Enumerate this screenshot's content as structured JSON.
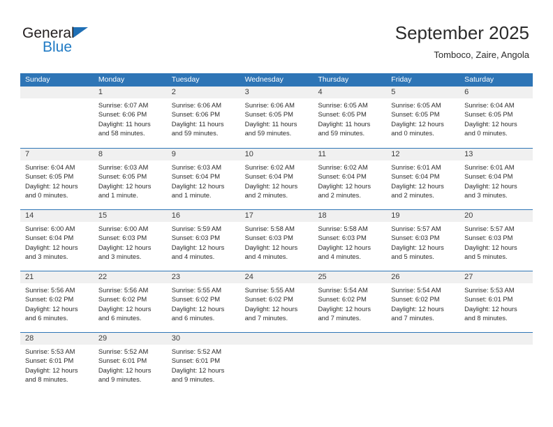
{
  "brand": {
    "name_top": "General",
    "name_bottom": "Blue",
    "triangle_icon": "triangle-icon",
    "color_primary": "#1f7ac4",
    "color_text": "#231f20"
  },
  "header": {
    "title": "September 2025",
    "subtitle": "Tomboco, Zaire, Angola"
  },
  "theme": {
    "header_row_bg": "#2e75b6",
    "day_number_bg": "#f0f0f0",
    "week_separator": "#2e75b6",
    "text": "#2b2b2b"
  },
  "weekdays": [
    "Sunday",
    "Monday",
    "Tuesday",
    "Wednesday",
    "Thursday",
    "Friday",
    "Saturday"
  ],
  "weeks": [
    [
      {
        "day": "",
        "empty": true,
        "sunrise": "",
        "sunset": "",
        "daylight_line1": "",
        "daylight_line2": ""
      },
      {
        "day": "1",
        "sunrise": "Sunrise: 6:07 AM",
        "sunset": "Sunset: 6:06 PM",
        "daylight_line1": "Daylight: 11 hours",
        "daylight_line2": "and 58 minutes."
      },
      {
        "day": "2",
        "sunrise": "Sunrise: 6:06 AM",
        "sunset": "Sunset: 6:06 PM",
        "daylight_line1": "Daylight: 11 hours",
        "daylight_line2": "and 59 minutes."
      },
      {
        "day": "3",
        "sunrise": "Sunrise: 6:06 AM",
        "sunset": "Sunset: 6:05 PM",
        "daylight_line1": "Daylight: 11 hours",
        "daylight_line2": "and 59 minutes."
      },
      {
        "day": "4",
        "sunrise": "Sunrise: 6:05 AM",
        "sunset": "Sunset: 6:05 PM",
        "daylight_line1": "Daylight: 11 hours",
        "daylight_line2": "and 59 minutes."
      },
      {
        "day": "5",
        "sunrise": "Sunrise: 6:05 AM",
        "sunset": "Sunset: 6:05 PM",
        "daylight_line1": "Daylight: 12 hours",
        "daylight_line2": "and 0 minutes."
      },
      {
        "day": "6",
        "sunrise": "Sunrise: 6:04 AM",
        "sunset": "Sunset: 6:05 PM",
        "daylight_line1": "Daylight: 12 hours",
        "daylight_line2": "and 0 minutes."
      }
    ],
    [
      {
        "day": "7",
        "sunrise": "Sunrise: 6:04 AM",
        "sunset": "Sunset: 6:05 PM",
        "daylight_line1": "Daylight: 12 hours",
        "daylight_line2": "and 0 minutes."
      },
      {
        "day": "8",
        "sunrise": "Sunrise: 6:03 AM",
        "sunset": "Sunset: 6:05 PM",
        "daylight_line1": "Daylight: 12 hours",
        "daylight_line2": "and 1 minute."
      },
      {
        "day": "9",
        "sunrise": "Sunrise: 6:03 AM",
        "sunset": "Sunset: 6:04 PM",
        "daylight_line1": "Daylight: 12 hours",
        "daylight_line2": "and 1 minute."
      },
      {
        "day": "10",
        "sunrise": "Sunrise: 6:02 AM",
        "sunset": "Sunset: 6:04 PM",
        "daylight_line1": "Daylight: 12 hours",
        "daylight_line2": "and 2 minutes."
      },
      {
        "day": "11",
        "sunrise": "Sunrise: 6:02 AM",
        "sunset": "Sunset: 6:04 PM",
        "daylight_line1": "Daylight: 12 hours",
        "daylight_line2": "and 2 minutes."
      },
      {
        "day": "12",
        "sunrise": "Sunrise: 6:01 AM",
        "sunset": "Sunset: 6:04 PM",
        "daylight_line1": "Daylight: 12 hours",
        "daylight_line2": "and 2 minutes."
      },
      {
        "day": "13",
        "sunrise": "Sunrise: 6:01 AM",
        "sunset": "Sunset: 6:04 PM",
        "daylight_line1": "Daylight: 12 hours",
        "daylight_line2": "and 3 minutes."
      }
    ],
    [
      {
        "day": "14",
        "sunrise": "Sunrise: 6:00 AM",
        "sunset": "Sunset: 6:04 PM",
        "daylight_line1": "Daylight: 12 hours",
        "daylight_line2": "and 3 minutes."
      },
      {
        "day": "15",
        "sunrise": "Sunrise: 6:00 AM",
        "sunset": "Sunset: 6:03 PM",
        "daylight_line1": "Daylight: 12 hours",
        "daylight_line2": "and 3 minutes."
      },
      {
        "day": "16",
        "sunrise": "Sunrise: 5:59 AM",
        "sunset": "Sunset: 6:03 PM",
        "daylight_line1": "Daylight: 12 hours",
        "daylight_line2": "and 4 minutes."
      },
      {
        "day": "17",
        "sunrise": "Sunrise: 5:58 AM",
        "sunset": "Sunset: 6:03 PM",
        "daylight_line1": "Daylight: 12 hours",
        "daylight_line2": "and 4 minutes."
      },
      {
        "day": "18",
        "sunrise": "Sunrise: 5:58 AM",
        "sunset": "Sunset: 6:03 PM",
        "daylight_line1": "Daylight: 12 hours",
        "daylight_line2": "and 4 minutes."
      },
      {
        "day": "19",
        "sunrise": "Sunrise: 5:57 AM",
        "sunset": "Sunset: 6:03 PM",
        "daylight_line1": "Daylight: 12 hours",
        "daylight_line2": "and 5 minutes."
      },
      {
        "day": "20",
        "sunrise": "Sunrise: 5:57 AM",
        "sunset": "Sunset: 6:03 PM",
        "daylight_line1": "Daylight: 12 hours",
        "daylight_line2": "and 5 minutes."
      }
    ],
    [
      {
        "day": "21",
        "sunrise": "Sunrise: 5:56 AM",
        "sunset": "Sunset: 6:02 PM",
        "daylight_line1": "Daylight: 12 hours",
        "daylight_line2": "and 6 minutes."
      },
      {
        "day": "22",
        "sunrise": "Sunrise: 5:56 AM",
        "sunset": "Sunset: 6:02 PM",
        "daylight_line1": "Daylight: 12 hours",
        "daylight_line2": "and 6 minutes."
      },
      {
        "day": "23",
        "sunrise": "Sunrise: 5:55 AM",
        "sunset": "Sunset: 6:02 PM",
        "daylight_line1": "Daylight: 12 hours",
        "daylight_line2": "and 6 minutes."
      },
      {
        "day": "24",
        "sunrise": "Sunrise: 5:55 AM",
        "sunset": "Sunset: 6:02 PM",
        "daylight_line1": "Daylight: 12 hours",
        "daylight_line2": "and 7 minutes."
      },
      {
        "day": "25",
        "sunrise": "Sunrise: 5:54 AM",
        "sunset": "Sunset: 6:02 PM",
        "daylight_line1": "Daylight: 12 hours",
        "daylight_line2": "and 7 minutes."
      },
      {
        "day": "26",
        "sunrise": "Sunrise: 5:54 AM",
        "sunset": "Sunset: 6:02 PM",
        "daylight_line1": "Daylight: 12 hours",
        "daylight_line2": "and 7 minutes."
      },
      {
        "day": "27",
        "sunrise": "Sunrise: 5:53 AM",
        "sunset": "Sunset: 6:01 PM",
        "daylight_line1": "Daylight: 12 hours",
        "daylight_line2": "and 8 minutes."
      }
    ],
    [
      {
        "day": "28",
        "sunrise": "Sunrise: 5:53 AM",
        "sunset": "Sunset: 6:01 PM",
        "daylight_line1": "Daylight: 12 hours",
        "daylight_line2": "and 8 minutes."
      },
      {
        "day": "29",
        "sunrise": "Sunrise: 5:52 AM",
        "sunset": "Sunset: 6:01 PM",
        "daylight_line1": "Daylight: 12 hours",
        "daylight_line2": "and 9 minutes."
      },
      {
        "day": "30",
        "sunrise": "Sunrise: 5:52 AM",
        "sunset": "Sunset: 6:01 PM",
        "daylight_line1": "Daylight: 12 hours",
        "daylight_line2": "and 9 minutes."
      },
      {
        "day": "",
        "empty": true,
        "sunrise": "",
        "sunset": "",
        "daylight_line1": "",
        "daylight_line2": ""
      },
      {
        "day": "",
        "empty": true,
        "sunrise": "",
        "sunset": "",
        "daylight_line1": "",
        "daylight_line2": ""
      },
      {
        "day": "",
        "empty": true,
        "sunrise": "",
        "sunset": "",
        "daylight_line1": "",
        "daylight_line2": ""
      },
      {
        "day": "",
        "empty": true,
        "sunrise": "",
        "sunset": "",
        "daylight_line1": "",
        "daylight_line2": ""
      }
    ]
  ]
}
